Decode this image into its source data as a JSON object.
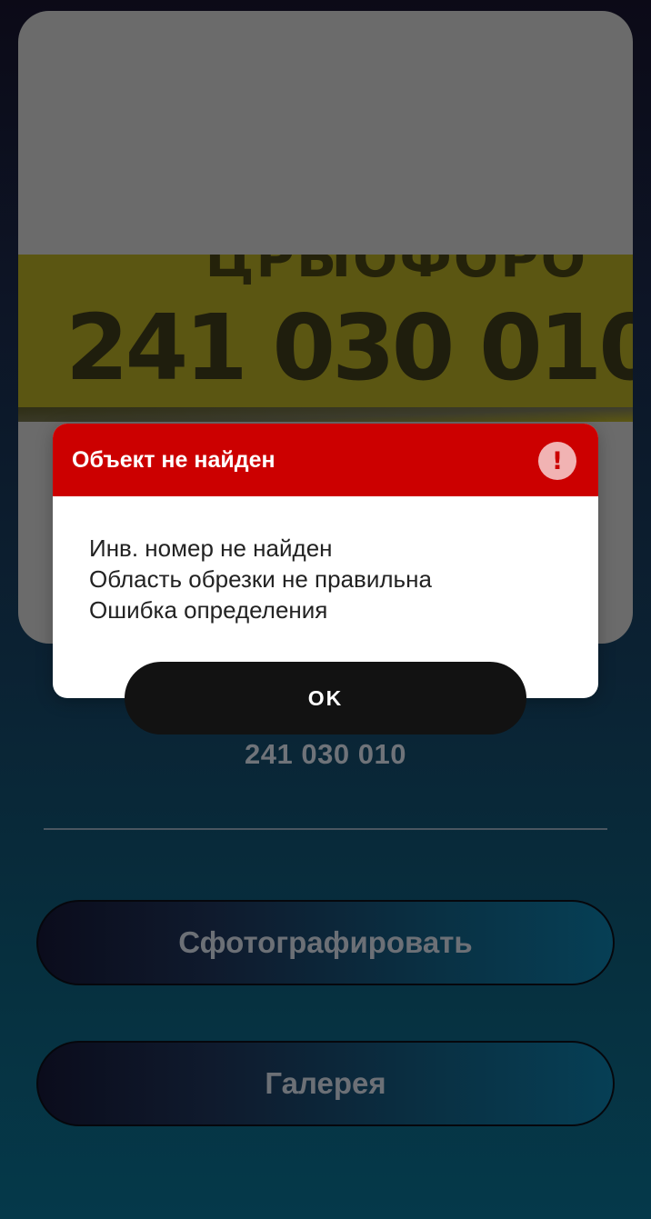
{
  "preview": {
    "plate_top_text": "ЦРЫОФОРО",
    "plate_number": "241 030 010"
  },
  "detected_number": "241 030 010",
  "buttons": {
    "photo_label": "Сфотографировать",
    "gallery_label": "Галерея"
  },
  "dialog": {
    "title": "Объект не найден",
    "icon": "alert-circle-icon",
    "icon_glyph": "!",
    "messages": [
      "Инв. номер не найден",
      "Область обрезки не правильна",
      "Ошибка определения"
    ],
    "ok_label": "OK"
  },
  "colors": {
    "dialog_header": "#cc0000",
    "ok_button": "#121212",
    "plate_yellow": "#5b5612"
  }
}
